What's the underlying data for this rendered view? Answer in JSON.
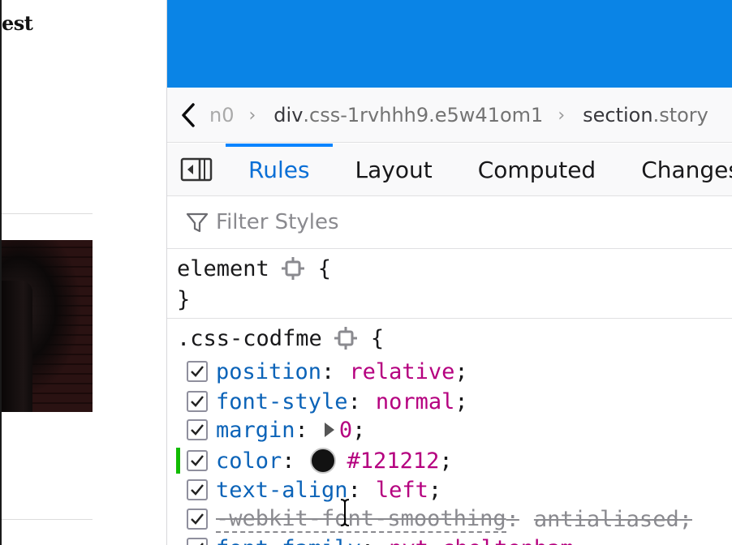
{
  "page": {
    "heading_fragment": "est"
  },
  "breadcrumbs": {
    "items": [
      {
        "tag": "",
        "cls": "n0"
      },
      {
        "tag": "div",
        "cls": ".css-1rvhhh9.e5w41om1"
      },
      {
        "tag": "section",
        "cls": ".story"
      }
    ]
  },
  "tabs": [
    "Rules",
    "Layout",
    "Computed",
    "Changes"
  ],
  "active_tab": "Rules",
  "filter": {
    "placeholder": "Filter Styles",
    "value": ""
  },
  "rules": {
    "element_rule": {
      "selector": "element",
      "open": "{",
      "close": "}"
    },
    "main_rule": {
      "selector": ".css-codfme",
      "open": "{",
      "declarations": [
        {
          "prop": "position",
          "value": "relative",
          "checked": true
        },
        {
          "prop": "font-style",
          "value": "normal",
          "checked": true
        },
        {
          "prop": "margin",
          "value": "0",
          "checked": true,
          "expandable": true
        },
        {
          "prop": "color",
          "value": "#121212",
          "checked": true,
          "changed": true,
          "swatch": "#121212"
        },
        {
          "prop": "text-align",
          "value": "left",
          "checked": true
        },
        {
          "prop": "-webkit-font-smoothing",
          "value": "antialiased",
          "checked": true,
          "overridden": true
        },
        {
          "prop": "font-family",
          "value": "nyt-cheltenham",
          "checked": true,
          "partial": true
        }
      ]
    }
  },
  "colors": {
    "accent": "#0a84ff",
    "viewport": "#0a84e6",
    "property": "#0b63b8",
    "value": "#b5007f",
    "changed_marker": "#12bc00"
  }
}
